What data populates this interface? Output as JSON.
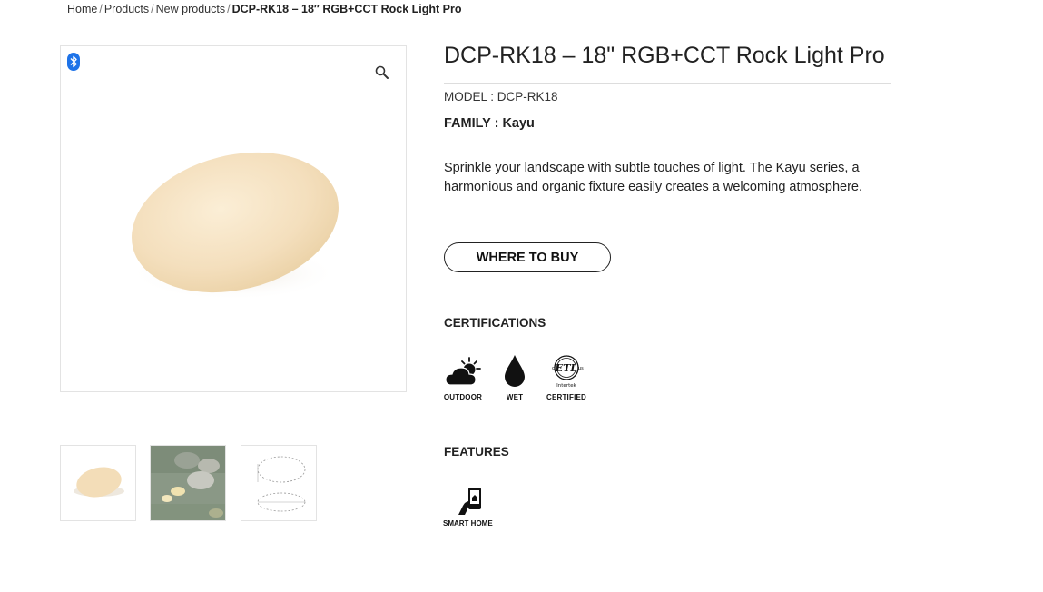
{
  "breadcrumb": {
    "items": [
      "Home",
      "Products",
      "New products"
    ],
    "separator": "/",
    "current": "DCP-RK18 – 18″ RGB+CCT Rock Light Pro"
  },
  "product": {
    "title": "DCP-RK18 – 18\" RGB+CCT Rock Light Pro",
    "model_label": "MODEL : DCP-RK18",
    "family_label": "FAMILY : Kayu",
    "description": "Sprinkle your landscape with subtle touches of light. The Kayu series, a harmonious and organic fixture easily creates a welcoming atmosphere.",
    "where_to_buy_label": "WHERE TO BUY"
  },
  "gallery": {
    "badge_icon": "bluetooth-icon",
    "zoom_icon": "magnifier-icon",
    "thumbnails": [
      "rock-light-photo",
      "garden-scene-photo",
      "dimension-drawing"
    ]
  },
  "certifications": {
    "heading": "CERTIFICATIONS",
    "items": [
      {
        "label": "OUTDOOR",
        "icon": "cloud-sun-icon"
      },
      {
        "label": "WET",
        "icon": "water-drop-icon"
      },
      {
        "label": "CERTIFIED",
        "icon": "etl-intertek-icon",
        "mark_text": "ETL",
        "mark_sub": "Intertek"
      }
    ]
  },
  "features": {
    "heading": "FEATURES",
    "items": [
      {
        "label": "SMART HOME",
        "icon": "hand-phone-icon"
      }
    ]
  },
  "colors": {
    "bluetooth": "#1e73e8",
    "rock_fill": "#f4e1c0",
    "text": "#222222"
  }
}
